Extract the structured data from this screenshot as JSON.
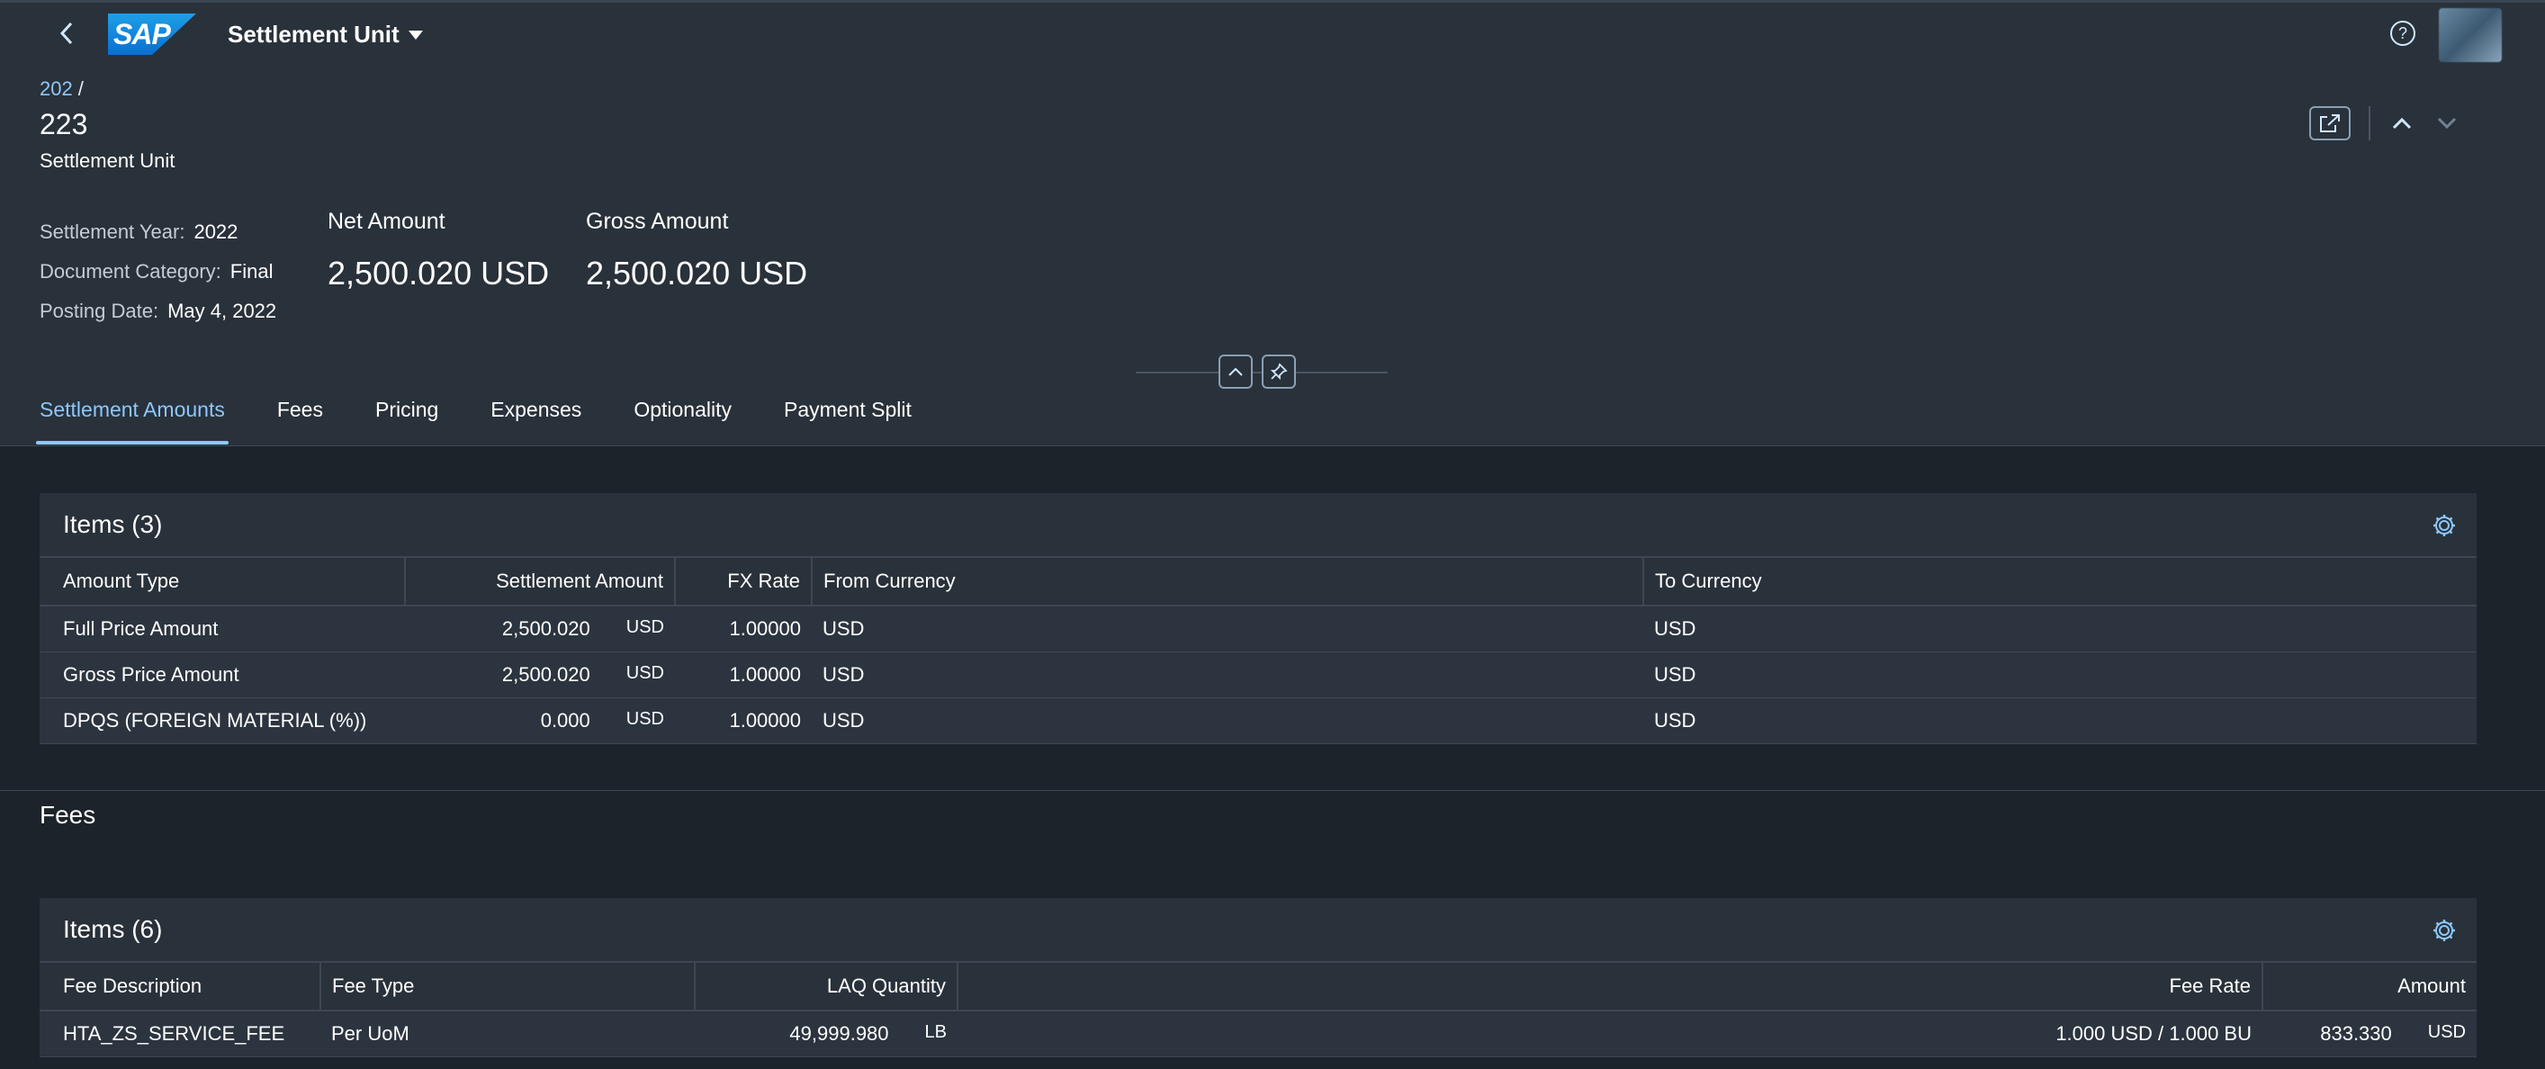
{
  "shell": {
    "app_title": "Settlement Unit",
    "logo_text": "SAP",
    "help_icon": "help-icon",
    "avatar": "user-avatar"
  },
  "header": {
    "breadcrumb_link": "202",
    "breadcrumb_sep": "/",
    "title": "223",
    "subtitle": "Settlement Unit",
    "attributes": [
      {
        "label": "Settlement Year:",
        "value": "2022"
      },
      {
        "label": "Document Category:",
        "value": "Final"
      },
      {
        "label": "Posting Date:",
        "value": "May 4, 2022"
      }
    ],
    "kpis": [
      {
        "label": "Net Amount",
        "value": "2,500.020 USD"
      },
      {
        "label": "Gross Amount",
        "value": "2,500.020 USD"
      }
    ]
  },
  "tabs": [
    {
      "label": "Settlement Amounts",
      "active": true
    },
    {
      "label": "Fees",
      "active": false
    },
    {
      "label": "Pricing",
      "active": false
    },
    {
      "label": "Expenses",
      "active": false
    },
    {
      "label": "Optionality",
      "active": false
    },
    {
      "label": "Payment Split",
      "active": false
    }
  ],
  "settlement_amounts": {
    "title": "Items (3)",
    "columns": [
      "Amount Type",
      "Settlement Amount",
      "FX Rate",
      "From Currency",
      "To Currency"
    ],
    "rows": [
      {
        "amount_type": "Full Price Amount",
        "amount": "2,500.020",
        "unit": "USD",
        "fx_rate": "1.00000",
        "from": "USD",
        "to": "USD"
      },
      {
        "amount_type": "Gross Price Amount",
        "amount": "2,500.020",
        "unit": "USD",
        "fx_rate": "1.00000",
        "from": "USD",
        "to": "USD"
      },
      {
        "amount_type": "DPQS (FOREIGN MATERIAL (%))",
        "amount": "0.000",
        "unit": "USD",
        "fx_rate": "1.00000",
        "from": "USD",
        "to": "USD"
      }
    ]
  },
  "fees_section": {
    "section_title": "Fees",
    "title": "Items (6)",
    "columns": [
      "Fee Description",
      "Fee Type",
      "LAQ Quantity",
      "Fee Rate",
      "Amount"
    ],
    "rows": [
      {
        "description": "HTA_ZS_SERVICE_FEE",
        "type": "Per UoM",
        "quantity": "49,999.980",
        "qty_unit": "LB",
        "rate": "1.000 USD / 1.000 BU",
        "amount": "833.330",
        "amount_unit": "USD"
      }
    ]
  },
  "colors": {
    "accent": "#8cc8ff",
    "shell_bg": "#29313a",
    "page_bg": "#1d232a"
  }
}
